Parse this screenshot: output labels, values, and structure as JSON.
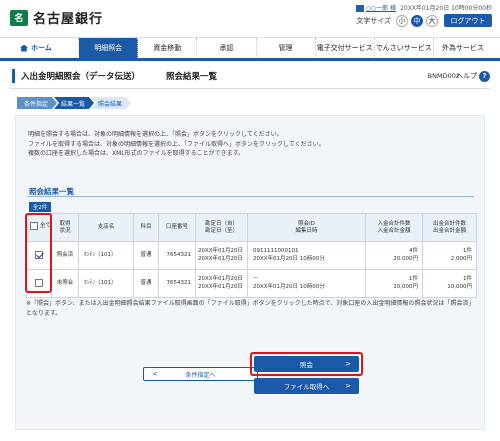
{
  "header": {
    "bank_logo_mark": "名",
    "bank_name": "名古屋銀行",
    "user_line": "○○一郎 様  20XX年01月20日 10時00分00秒",
    "user_name": "○○一郎 様",
    "user_datetime": "20XX年01月20日 10時00分00秒",
    "font_size_label": "文字サイズ",
    "font_sizes": [
      "小",
      "中",
      "大"
    ],
    "font_size_selected": "中",
    "logout_label": "ログアウト"
  },
  "nav": {
    "items": [
      {
        "label": "ホーム",
        "icon": "home-icon"
      },
      {
        "label": "明細照会"
      },
      {
        "label": "資金移動"
      },
      {
        "label": "承認"
      },
      {
        "label": "管理"
      },
      {
        "label": "電子交付サービス"
      },
      {
        "label": "でんさいサービス"
      },
      {
        "label": "外為サービス"
      }
    ],
    "active": "明細照会"
  },
  "title": {
    "page_title": "入出金明細照会（データ伝送）",
    "screen_name": "照会結果一覧",
    "screen_id": "BNMD002",
    "help_label": "ヘルプ",
    "help_icon": "?"
  },
  "steps": [
    "条件指定",
    "結果一覧",
    "照会結果"
  ],
  "instructions": [
    "明細を照会する場合は、対象の明細情報を選択の上、「照会」ボタンをクリックしてください。",
    "ファイルを取得する場合は、対象の明細情報を選択の上、「ファイル取得へ」ボタンをクリックしてください。",
    "複数の口座を選択した場合は、XML形式のファイルを取得することができます。"
  ],
  "result": {
    "section_title": "照会結果一覧",
    "count_badge": "全2件",
    "headers": {
      "all": "全て",
      "status": [
        "取得",
        "状況"
      ],
      "account_name": "支店名",
      "type": "科目",
      "account_no": "口座番号",
      "period": [
        "勘定日（自）",
        "勘定日（至）"
      ],
      "inquiry": [
        "照会ID",
        "編集日時"
      ],
      "deposit": [
        "入金合計件数",
        "入金合計金額"
      ],
      "withdraw": [
        "出金合計件数",
        "出金合計金額"
      ]
    },
    "rows": [
      {
        "checked": true,
        "status": "照会済",
        "branch": "ﾎﾝﾃﾝ（101）",
        "type": "普通",
        "account_no": "7654321",
        "date_from": "20XX年01月20日",
        "date_to": "20XX年01月20日",
        "inquiry_id": "0911111000101",
        "edited_at": "20XX年01月20日 10時00分",
        "deposit_count": "4件",
        "deposit_amount": "20,000円",
        "withdraw_count": "1件",
        "withdraw_amount": "2,000円"
      },
      {
        "checked": false,
        "status": "未照会",
        "branch": "ﾎﾝﾃﾝ（101）",
        "type": "普通",
        "account_no": "7654321",
        "date_from": "20XX年01月20日",
        "date_to": "20XX年01月20日",
        "inquiry_id": "－",
        "edited_at": "20XX年01月20日 10時00分",
        "deposit_count": "1件",
        "deposit_amount": "10,000円",
        "withdraw_count": "1件",
        "withdraw_amount": "10,000円"
      }
    ]
  },
  "note": "※「照会」ボタン、または入出金明細照会結果ファイル取得画面の「ファイル取得」ボタンをクリックした時点で、対象口座の入出金明細情報の照会状況は「照会済」となります。",
  "buttons": {
    "back": "条件指定へ",
    "inquire": "照会",
    "file": "ファイル取得へ"
  },
  "colors": {
    "primary": "#1a5aa8",
    "highlight": "#e0141e",
    "logo_green": "#0f7a4a"
  }
}
